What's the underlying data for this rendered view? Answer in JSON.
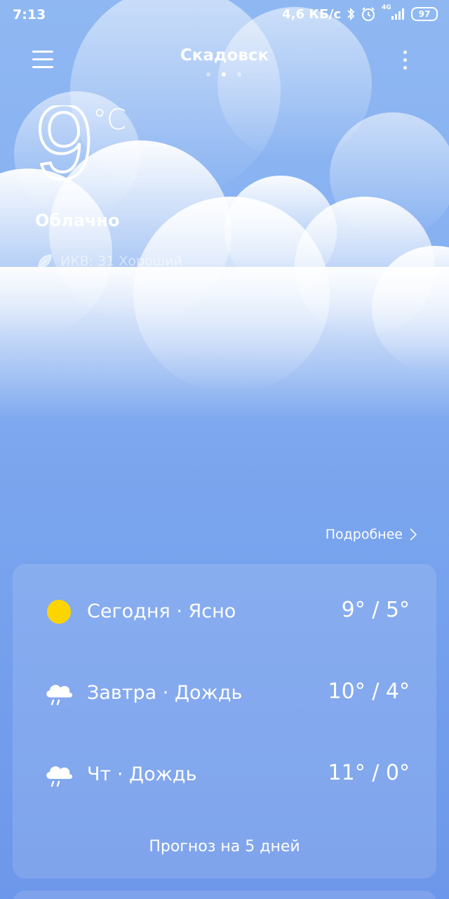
{
  "status_bar": {
    "time": "7:13",
    "speed": "4,6 КБ/с",
    "network": "4G",
    "battery": "97"
  },
  "header": {
    "city": "Скадовск",
    "page_count": 3,
    "active_page": 2
  },
  "current": {
    "temperature": "9",
    "unit": "°C",
    "condition": "Облачно",
    "aqi": "ИКВ: 31 Хороший"
  },
  "details_link": "Подробнее",
  "forecast": {
    "days": [
      {
        "label": "Сегодня · Ясно",
        "temps": "9° / 5°",
        "icon": "sun-icon"
      },
      {
        "label": "Завтра · Дождь",
        "temps": "10° / 4°",
        "icon": "rain-cloud-icon"
      },
      {
        "label": "Чт · Дождь",
        "temps": "11° / 0°",
        "icon": "rain-cloud-icon"
      }
    ],
    "more_label": "Прогноз на 5 дней"
  },
  "colors": {
    "sun": "#fcd500",
    "background_top": "#8fb8f2",
    "background_bottom": "#6d97ea"
  }
}
